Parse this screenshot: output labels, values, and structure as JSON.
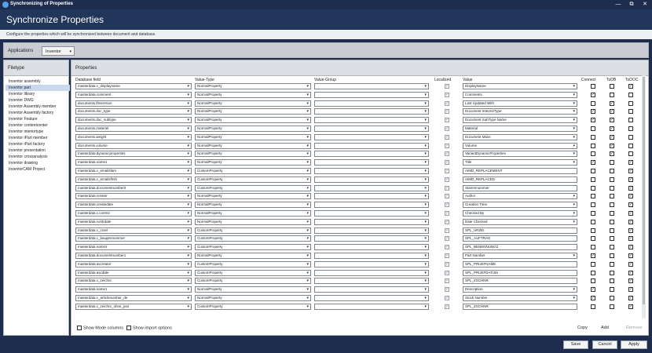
{
  "window": {
    "title": "Synchronizing of Properties",
    "minimize": "—",
    "restore": "⧉",
    "close": "✕"
  },
  "header": {
    "title": "Synchronize Properties",
    "description": "Configure the properties which will be synchronized between document and database."
  },
  "applications": {
    "label": "Applications",
    "selected": "Inventor"
  },
  "filetype": {
    "heading": "Filetype",
    "items": [
      "Inventor assembly",
      "Inventor part",
      "Inventor library",
      "Inventor DWG",
      "Inventor Assembly member",
      "Inventor Assembly factory",
      "Inventor Feature",
      "Inventor contentcenter",
      "Inventor interiortype",
      "Inventor iPart member",
      "Inventor iPart factory",
      "Inventor presentation",
      "Inventor crossanalysis",
      "Inventor drawing",
      "InventorCAM Project"
    ],
    "selected_index": 1
  },
  "properties": {
    "heading": "Properties",
    "columns": {
      "db": "Database field",
      "vt": "Value-Type",
      "vg": "Value-Group",
      "loc": "Localized",
      "val": "Value",
      "connect": "Connect",
      "todb": "ToDB",
      "todoc": "ToDOC"
    },
    "rows": [
      {
        "db": "masterdata.c_displayname",
        "vt": "NormalProperty",
        "val": "DisplayName",
        "loc": false,
        "connect": false,
        "todb": false,
        "todoc": true,
        "vdd": true
      },
      {
        "db": "masterdata.comment",
        "vt": "NormalProperty",
        "val": "Comments",
        "loc": false,
        "connect": true,
        "todb": false,
        "todoc": false,
        "vdd": true
      },
      {
        "db": "documents.fileversion",
        "vt": "NormalProperty",
        "val": "Last Updated With",
        "loc": false,
        "connect": false,
        "todb": true,
        "todoc": false,
        "vdd": true
      },
      {
        "db": "documents.doc_type",
        "vt": "NormalProperty",
        "val": "Document InterestType",
        "loc": false,
        "connect": true,
        "todb": true,
        "todoc": false,
        "vdd": true
      },
      {
        "db": "documents.doc_subtype",
        "vt": "NormalProperty",
        "val": "Document SubType Name",
        "loc": false,
        "connect": true,
        "todb": true,
        "todoc": false,
        "vdd": true
      },
      {
        "db": "documents.materiel",
        "vt": "NormalProperty",
        "val": "Material",
        "loc": false,
        "connect": false,
        "todb": true,
        "todoc": false,
        "vdd": true
      },
      {
        "db": "documents.weight",
        "vt": "NormalProperty",
        "val": "Document Mass",
        "loc": false,
        "connect": false,
        "todb": true,
        "todoc": false,
        "vdd": true
      },
      {
        "db": "documents.volume",
        "vt": "NormalProperty",
        "val": "Volume",
        "loc": false,
        "connect": false,
        "todb": true,
        "todoc": false,
        "vdd": true
      },
      {
        "db": "masterdata.dynamicproperties",
        "vt": "NormalProperty",
        "val": "VariantDynamicProperties",
        "loc": false,
        "connect": false,
        "todb": true,
        "todoc": false,
        "vdd": true
      },
      {
        "db": "masterdata.name1",
        "vt": "NormalProperty",
        "val": "Title",
        "loc": false,
        "connect": true,
        "todb": false,
        "todoc": true,
        "vdd": true
      },
      {
        "db": "masterdata.c_emailsfam",
        "vt": "CustomProperty",
        "val": "AIMD_REPLACEMENT",
        "loc": false,
        "connect": false,
        "todb": false,
        "todoc": true,
        "vdd": false
      },
      {
        "db": "masterdata.c_emailsflrsh",
        "vt": "CustomProperty",
        "val": "AIMD_REPLACED",
        "loc": false,
        "connect": false,
        "todb": false,
        "todoc": true,
        "vdd": false
      },
      {
        "db": "masterdata.documentnumber0",
        "vt": "CustomProperty",
        "val": "Stammnummer",
        "loc": false,
        "connect": false,
        "todb": false,
        "todoc": true,
        "vdd": false
      },
      {
        "db": "masterdata.creator",
        "vt": "NormalProperty",
        "val": "Author",
        "loc": false,
        "connect": false,
        "todb": false,
        "todoc": true,
        "vdd": true
      },
      {
        "db": "masterdata.createdate",
        "vt": "NormalProperty",
        "val": "Creation Time",
        "loc": false,
        "connect": false,
        "todb": false,
        "todoc": true,
        "vdd": true
      },
      {
        "db": "masterdata.c.contrsr",
        "vt": "NormalProperty",
        "val": "Checked By",
        "loc": false,
        "connect": false,
        "todb": false,
        "todoc": true,
        "vdd": true
      },
      {
        "db": "masterdata.contrdate",
        "vt": "NormalProperty",
        "val": "Date Checked",
        "loc": false,
        "connect": false,
        "todb": false,
        "todoc": true,
        "vdd": true
      },
      {
        "db": "masterdata.c_crsel",
        "vt": "CustomProperty",
        "val": "SPL_URZEI",
        "loc": false,
        "connect": false,
        "todb": false,
        "todoc": true,
        "vdd": false
      },
      {
        "db": "masterdata.c_baugennummer",
        "vt": "CustomProperty",
        "val": "SPL_AUFTRAG",
        "loc": false,
        "connect": false,
        "todb": false,
        "todoc": true,
        "vdd": false
      },
      {
        "db": "masterdata.name2",
        "vt": "CustomProperty",
        "val": "SPL_BENENNUNG2",
        "loc": false,
        "connect": false,
        "todb": false,
        "todoc": true,
        "vdd": false
      },
      {
        "db": "masterdata.documentnumber1",
        "vt": "NormalProperty",
        "val": "Part Number",
        "loc": false,
        "connect": true,
        "todb": false,
        "todoc": true,
        "vdd": true
      },
      {
        "db": "masterdata.ascreator",
        "vt": "CustomProperty",
        "val": "SPL_PRUEFNAME",
        "loc": false,
        "connect": false,
        "todb": false,
        "todoc": true,
        "vdd": false
      },
      {
        "db": "masterdata.ascdate",
        "vt": "CustomProperty",
        "val": "SPL_PRUEFDATUM",
        "loc": false,
        "connect": false,
        "todb": false,
        "todoc": true,
        "vdd": false
      },
      {
        "db": "masterdata.c_zeichnr",
        "vt": "CustomProperty",
        "val": "SPL_ZSCHNR",
        "loc": false,
        "connect": false,
        "todb": false,
        "todoc": true,
        "vdd": false
      },
      {
        "db": "masterdata.name1",
        "vt": "NormalProperty",
        "val": "Description",
        "loc": false,
        "connect": true,
        "todb": false,
        "todoc": true,
        "vdd": true
      },
      {
        "db": "masterdata.c_articlenumber_de",
        "vt": "NormalProperty",
        "val": "Stock Number",
        "loc": false,
        "connect": true,
        "todb": false,
        "todoc": true,
        "vdd": true
      },
      {
        "db": "masterdata.c_zeichnr_ohne_pos",
        "vt": "CustomProperty",
        "val": "SPL_ZSCHNR",
        "loc": false,
        "connect": false,
        "todb": false,
        "todoc": true,
        "vdd": false
      }
    ]
  },
  "options": {
    "show_mode_columns": "Show Mode columns",
    "show_import_options": "Show import options"
  },
  "actions": {
    "copy": "Copy",
    "add": "Add",
    "remove": "Remove"
  },
  "buttons": {
    "save": "Save",
    "cancel": "Cancel",
    "apply": "Apply"
  }
}
